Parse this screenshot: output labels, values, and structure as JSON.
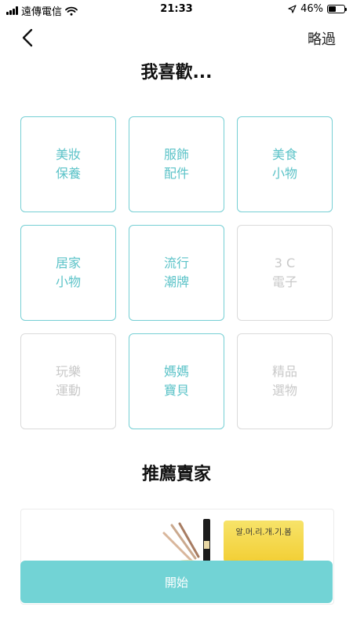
{
  "status_bar": {
    "carrier": "遠傳電信",
    "time": "21:33",
    "battery_percent": "46%",
    "battery_level": 0.46,
    "icons": [
      "signal-icon",
      "wifi-icon",
      "location-arrow-icon",
      "battery-icon"
    ]
  },
  "nav": {
    "back_icon": "chevron-left-icon",
    "skip_label": "略過"
  },
  "page_title": "我喜歡...",
  "interests": [
    {
      "line1": "美妝",
      "line2": "保養",
      "selected": true
    },
    {
      "line1": "服飾",
      "line2": "配件",
      "selected": true
    },
    {
      "line1": "美食",
      "line2": "小物",
      "selected": true
    },
    {
      "line1": "居家",
      "line2": "小物",
      "selected": true
    },
    {
      "line1": "流行",
      "line2": "潮牌",
      "selected": true
    },
    {
      "line1": "3 C",
      "line2": "電子",
      "selected": false
    },
    {
      "line1": "玩樂",
      "line2": "運動",
      "selected": false
    },
    {
      "line1": "媽媽",
      "line2": "寶貝",
      "selected": true
    },
    {
      "line1": "精品",
      "line2": "選物",
      "selected": false
    }
  ],
  "section_title": "推薦賣家",
  "seller_card": {
    "sticker_text": "알.머.리.개.기.봄"
  },
  "start_button": "開始",
  "colors": {
    "accent": "#72d3d5",
    "tile_border_selected": "#76cfd4",
    "tile_text_selected": "#5cc3c8",
    "tile_border_unselected": "#dadada",
    "tile_text_unselected": "#c9c9c9"
  }
}
